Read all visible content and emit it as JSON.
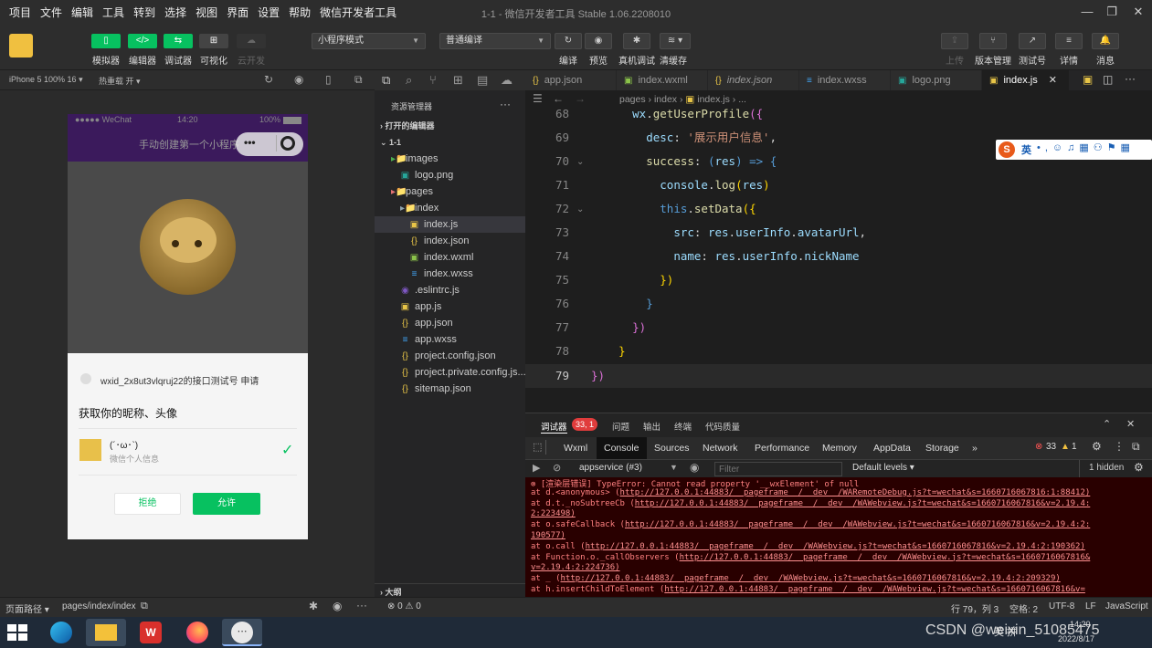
{
  "window": {
    "title": "1-1 - 微信开发者工具 Stable 1.06.2208010"
  },
  "menu": [
    "项目",
    "文件",
    "编辑",
    "工具",
    "转到",
    "选择",
    "视图",
    "界面",
    "设置",
    "帮助",
    "微信开发者工具"
  ],
  "toolbar": {
    "left_buttons": [
      {
        "icon": "phone-icon",
        "label": "模拟器",
        "glyph": "▯",
        "state": "on"
      },
      {
        "icon": "code-icon",
        "label": "编辑器",
        "glyph": "</>",
        "state": "on"
      },
      {
        "icon": "debug-icon",
        "label": "调试器",
        "glyph": "⇆",
        "state": "on"
      },
      {
        "icon": "visual-icon",
        "label": "可视化",
        "glyph": "⊞",
        "state": "off"
      },
      {
        "icon": "cloud-icon",
        "label": "云开发",
        "glyph": "☁",
        "state": "disabled"
      }
    ],
    "mode_select": "小程序模式",
    "compile_select": "普通编译",
    "mid_buttons": [
      {
        "icon": "refresh-icon",
        "label": "编译",
        "glyph": "↻"
      },
      {
        "icon": "eye-icon",
        "label": "预览",
        "glyph": "◉"
      },
      {
        "icon": "bug-icon",
        "label": "真机调试",
        "glyph": "✱"
      },
      {
        "icon": "layers-icon",
        "label": "清缓存",
        "glyph": "≋ ▾"
      }
    ],
    "right_buttons": [
      {
        "icon": "upload-icon",
        "label": "上传",
        "glyph": "⇪",
        "disabled": true
      },
      {
        "icon": "branch-icon",
        "label": "版本管理",
        "glyph": "⑂",
        "disabled": false
      },
      {
        "icon": "test-icon",
        "label": "测试号",
        "glyph": "↗",
        "disabled": false
      },
      {
        "icon": "menu-icon",
        "label": "详情",
        "glyph": "≡",
        "disabled": false
      },
      {
        "icon": "bell-icon",
        "label": "消息",
        "glyph": "🔔",
        "disabled": false
      }
    ]
  },
  "simulator": {
    "device": "iPhone 5 100% 16",
    "hot_reload": "热重载 开",
    "phone": {
      "carrier": "●●●●● WeChat",
      "time": "14:20",
      "battery": "100%",
      "nav_title": "手动创建第一个小程序",
      "dialog": {
        "app_line": "wxid_2x8ut3vlqruj22的接口测试号 申请",
        "title": "获取你的昵称、头像",
        "nickname": "(´･ω･`)",
        "subtitle": "微信个人信息",
        "reject": "拒绝",
        "allow": "允许"
      }
    }
  },
  "explorer": {
    "title": "资源管理器",
    "sections": {
      "open_editors": "打开的编辑器",
      "project": "1-1",
      "outline": "大纲"
    },
    "tree": [
      {
        "label": "images",
        "indent": 1,
        "icon": "folder-icon",
        "glyph": "▸📁",
        "color": "#4caf50",
        "selected": false
      },
      {
        "label": "logo.png",
        "indent": 2,
        "icon": "image-icon",
        "glyph": "▣",
        "color": "#26a69a",
        "selected": false
      },
      {
        "label": "pages",
        "indent": 1,
        "icon": "folder-icon",
        "glyph": "▸📁",
        "color": "#e57373",
        "selected": false
      },
      {
        "label": "index",
        "indent": 2,
        "icon": "folder-icon",
        "glyph": "▸📁",
        "color": "#90a4ae",
        "selected": false
      },
      {
        "label": "index.js",
        "indent": 3,
        "icon": "js-icon",
        "glyph": "▣",
        "color": "#e8c547",
        "selected": true
      },
      {
        "label": "index.json",
        "indent": 3,
        "icon": "json-icon",
        "glyph": "{}",
        "color": "#e8c547",
        "selected": false
      },
      {
        "label": "index.wxml",
        "indent": 3,
        "icon": "wxml-icon",
        "glyph": "▣",
        "color": "#8bc34a",
        "selected": false
      },
      {
        "label": "index.wxss",
        "indent": 3,
        "icon": "wxss-icon",
        "glyph": "≡",
        "color": "#42a5f5",
        "selected": false
      },
      {
        "label": ".eslintrc.js",
        "indent": 2,
        "icon": "eslint-icon",
        "glyph": "◉",
        "color": "#7e57c2",
        "selected": false
      },
      {
        "label": "app.js",
        "indent": 2,
        "icon": "js-icon",
        "glyph": "▣",
        "color": "#e8c547",
        "selected": false
      },
      {
        "label": "app.json",
        "indent": 2,
        "icon": "json-icon",
        "glyph": "{}",
        "color": "#e8c547",
        "selected": false
      },
      {
        "label": "app.wxss",
        "indent": 2,
        "icon": "wxss-icon",
        "glyph": "≡",
        "color": "#42a5f5",
        "selected": false
      },
      {
        "label": "project.config.json",
        "indent": 2,
        "icon": "json-icon",
        "glyph": "{}",
        "color": "#e8c547",
        "selected": false
      },
      {
        "label": "project.private.config.js...",
        "indent": 2,
        "icon": "json-icon",
        "glyph": "{}",
        "color": "#e8c547",
        "selected": false
      },
      {
        "label": "sitemap.json",
        "indent": 2,
        "icon": "json-icon",
        "glyph": "{}",
        "color": "#e8c547",
        "selected": false
      }
    ]
  },
  "editor": {
    "tabs": [
      {
        "label": "app.json",
        "icon": "json-icon",
        "glyph": "{}",
        "active": false,
        "italic": false
      },
      {
        "label": "index.wxml",
        "icon": "wxml-icon",
        "glyph": "▣",
        "active": false,
        "italic": false
      },
      {
        "label": "index.json",
        "icon": "json-icon",
        "glyph": "{}",
        "active": false,
        "italic": true
      },
      {
        "label": "index.wxss",
        "icon": "wxss-icon",
        "glyph": "≡",
        "active": false,
        "italic": false
      },
      {
        "label": "logo.png",
        "icon": "image-icon",
        "glyph": "▣",
        "active": false,
        "italic": false
      },
      {
        "label": "index.js",
        "icon": "js-icon",
        "glyph": "▣",
        "active": true,
        "italic": false
      }
    ],
    "breadcrumb": [
      "pages",
      "index",
      "index.js",
      "..."
    ],
    "lines": [
      68,
      69,
      70,
      71,
      72,
      73,
      74,
      75,
      76,
      77,
      78,
      79
    ],
    "current_line": 79,
    "ime_label": "英"
  },
  "devtools": {
    "top_tabs": [
      "调试器",
      "问题",
      "输出",
      "终端",
      "代码质量"
    ],
    "error_badge": "33, 1",
    "panel_tabs": [
      "Wxml",
      "Console",
      "Sources",
      "Network",
      "Performance",
      "Memory",
      "AppData",
      "Storage",
      "»"
    ],
    "active_panel": "Console",
    "errors": "33",
    "warnings": "1",
    "context": "appservice (#3)",
    "filter_placeholder": "Filter",
    "levels": "Default levels ▾",
    "hidden": "1 hidden",
    "console_lines": [
      {
        "text": "⊗ [渲染层错误] TypeError: Cannot read property '__wxElement' of null",
        "link": ""
      },
      {
        "text": "    at d.<anonymous> (",
        "link": "http://127.0.0.1:44883/__pageframe__/__dev__/WARemoteDebug.js?t=wechat&s=1660716067816:1:88412)"
      },
      {
        "text": "    at d.t._noSubtreeCb (",
        "link": "http://127.0.0.1:44883/__pageframe__/__dev__/WAWebview.js?t=wechat&s=1660716067816&v=2.19.4:"
      },
      {
        "text": "",
        "link": "2:223498)"
      },
      {
        "text": "    at o.safeCallback (",
        "link": "http://127.0.0.1:44883/__pageframe__/__dev__/WAWebview.js?t=wechat&s=1660716067816&v=2.19.4:2:"
      },
      {
        "text": "",
        "link": "190577)"
      },
      {
        "text": "    at o.call (",
        "link": "http://127.0.0.1:44883/__pageframe__/__dev__/WAWebview.js?t=wechat&s=1660716067816&v=2.19.4:2:190362)"
      },
      {
        "text": "    at Function.o._callObservers (",
        "link": "http://127.0.0.1:44883/__pageframe__/__dev__/WAWebview.js?t=wechat&s=1660716067816&"
      },
      {
        "text": "",
        "link": "v=2.19.4:2:224736)"
      },
      {
        "text": "    at _ (",
        "link": "http://127.0.0.1:44883/__pageframe__/__dev__/WAWebview.js?t=wechat&s=1660716067816&v=2.19.4:2:209329)"
      },
      {
        "text": "    at h.insertChildToElement (",
        "link": "http://127.0.0.1:44883/__pageframe__/__dev__/WAWebview.js?t=wechat&s=1660716067816&v="
      }
    ]
  },
  "statusbar": {
    "page_path_label": "页面路径 ▾",
    "page_path": "pages/index/index",
    "problems": "⊗ 0 ⚠ 0",
    "position": "行 79，列 3",
    "spaces": "空格: 2",
    "encoding": "UTF-8",
    "eol": "LF",
    "language": "JavaScript"
  },
  "taskbar": {
    "watermark": "CSDN @weixin_51085475",
    "time": "14:20",
    "date": "2022/8/17",
    "ime": "英 拼"
  }
}
